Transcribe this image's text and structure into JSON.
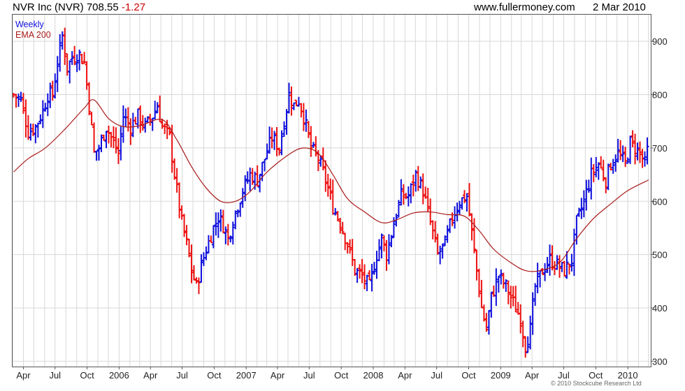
{
  "header": {
    "title": "NVR Inc (NVR) 708.55",
    "change": "-1.27",
    "site": "www.fullermoney.com",
    "date": "2 Mar 2010"
  },
  "copyright": "© 2010 Stockcube Research Ltd",
  "colors": {
    "up": "#1010dd",
    "down": "#ee1111",
    "ema": "#aa1a1a",
    "grid": "#d8d8d8",
    "frame": "#555555",
    "change_text": "#cc0000"
  },
  "chart_data": {
    "type": "ohlc-bar",
    "title": "NVR Inc (NVR) 708.55 -1.27",
    "legend": [
      "Weekly",
      "EMA 200"
    ],
    "legend_placement": "top-left",
    "grid": true,
    "y_axis_side": "right",
    "ylim": [
      290,
      950
    ],
    "y_ticks": [
      300,
      400,
      500,
      600,
      700,
      800,
      900
    ],
    "x_ticks": [
      "Apr",
      "Jul",
      "Oct",
      "2006",
      "Apr",
      "Jul",
      "Oct",
      "2007",
      "Apr",
      "Jul",
      "Oct",
      "2008",
      "Apr",
      "Jul",
      "Oct",
      "2009",
      "Apr",
      "Jul",
      "Oct",
      "2010"
    ],
    "x_tick_dates": [
      "2005-04-01",
      "2005-07-01",
      "2005-10-01",
      "2006-01-01",
      "2006-04-01",
      "2006-07-01",
      "2006-10-01",
      "2007-01-01",
      "2007-04-01",
      "2007-07-01",
      "2007-10-01",
      "2008-01-01",
      "2008-04-01",
      "2008-07-01",
      "2008-10-01",
      "2009-01-01",
      "2009-04-01",
      "2009-07-01",
      "2009-10-01",
      "2010-01-01"
    ],
    "x_range": [
      "2005-03-01",
      "2010-03-08"
    ],
    "weekly_close_anchors": [
      [
        "2005-03-04",
        800
      ],
      [
        "2005-03-25",
        790
      ],
      [
        "2005-04-15",
        730
      ],
      [
        "2005-05-06",
        740
      ],
      [
        "2005-05-27",
        770
      ],
      [
        "2005-06-10",
        800
      ],
      [
        "2005-06-24",
        800
      ],
      [
        "2005-07-08",
        860
      ],
      [
        "2005-07-22",
        910
      ],
      [
        "2005-08-05",
        850
      ],
      [
        "2005-08-19",
        870
      ],
      [
        "2005-09-09",
        875
      ],
      [
        "2005-09-23",
        860
      ],
      [
        "2005-10-07",
        780
      ],
      [
        "2005-10-21",
        690
      ],
      [
        "2005-11-04",
        700
      ],
      [
        "2005-11-25",
        740
      ],
      [
        "2005-12-09",
        720
      ],
      [
        "2005-12-30",
        690
      ],
      [
        "2006-01-13",
        760
      ],
      [
        "2006-02-03",
        740
      ],
      [
        "2006-02-24",
        760
      ],
      [
        "2006-03-17",
        740
      ],
      [
        "2006-04-07",
        760
      ],
      [
        "2006-04-21",
        780
      ],
      [
        "2006-05-05",
        740
      ],
      [
        "2006-05-26",
        720
      ],
      [
        "2006-06-09",
        650
      ],
      [
        "2006-06-30",
        560
      ],
      [
        "2006-07-14",
        520
      ],
      [
        "2006-07-28",
        470
      ],
      [
        "2006-08-11",
        440
      ],
      [
        "2006-08-25",
        480
      ],
      [
        "2006-09-08",
        510
      ],
      [
        "2006-09-29",
        550
      ],
      [
        "2006-10-13",
        570
      ],
      [
        "2006-10-27",
        555
      ],
      [
        "2006-11-10",
        530
      ],
      [
        "2006-12-01",
        580
      ],
      [
        "2006-12-22",
        620
      ],
      [
        "2007-01-12",
        650
      ],
      [
        "2007-02-02",
        640
      ],
      [
        "2007-02-23",
        680
      ],
      [
        "2007-03-16",
        720
      ],
      [
        "2007-04-06",
        700
      ],
      [
        "2007-04-20",
        750
      ],
      [
        "2007-05-04",
        800
      ],
      [
        "2007-05-18",
        780
      ],
      [
        "2007-06-01",
        790
      ],
      [
        "2007-06-15",
        760
      ],
      [
        "2007-07-06",
        700
      ],
      [
        "2007-07-27",
        680
      ],
      [
        "2007-08-17",
        640
      ],
      [
        "2007-09-07",
        590
      ],
      [
        "2007-09-28",
        560
      ],
      [
        "2007-10-19",
        520
      ],
      [
        "2007-11-09",
        470
      ],
      [
        "2007-11-30",
        460
      ],
      [
        "2007-12-21",
        440
      ],
      [
        "2008-01-11",
        500
      ],
      [
        "2008-01-25",
        530
      ],
      [
        "2008-02-08",
        500
      ],
      [
        "2008-02-29",
        560
      ],
      [
        "2008-03-21",
        610
      ],
      [
        "2008-04-11",
        610
      ],
      [
        "2008-05-02",
        650
      ],
      [
        "2008-05-23",
        620
      ],
      [
        "2008-06-13",
        560
      ],
      [
        "2008-07-04",
        500
      ],
      [
        "2008-07-25",
        520
      ],
      [
        "2008-08-15",
        570
      ],
      [
        "2008-09-05",
        600
      ],
      [
        "2008-09-26",
        610
      ],
      [
        "2008-10-10",
        540
      ],
      [
        "2008-10-24",
        470
      ],
      [
        "2008-11-07",
        400
      ],
      [
        "2008-11-21",
        360
      ],
      [
        "2008-12-05",
        420
      ],
      [
        "2008-12-26",
        460
      ],
      [
        "2009-01-16",
        440
      ],
      [
        "2009-02-06",
        410
      ],
      [
        "2009-02-27",
        380
      ],
      [
        "2009-03-13",
        330
      ],
      [
        "2009-03-27",
        360
      ],
      [
        "2009-04-10",
        440
      ],
      [
        "2009-05-01",
        470
      ],
      [
        "2009-05-22",
        490
      ],
      [
        "2009-06-12",
        480
      ],
      [
        "2009-07-03",
        470
      ],
      [
        "2009-07-24",
        490
      ],
      [
        "2009-08-07",
        560
      ],
      [
        "2009-08-28",
        600
      ],
      [
        "2009-09-18",
        650
      ],
      [
        "2009-10-09",
        670
      ],
      [
        "2009-10-30",
        640
      ],
      [
        "2009-11-13",
        670
      ],
      [
        "2009-12-04",
        690
      ],
      [
        "2009-12-25",
        670
      ],
      [
        "2010-01-08",
        710
      ],
      [
        "2010-01-22",
        700
      ],
      [
        "2010-02-05",
        690
      ],
      [
        "2010-02-19",
        670
      ],
      [
        "2010-03-02",
        708.55
      ]
    ],
    "ema200_anchors": [
      [
        "2005-03-04",
        655
      ],
      [
        "2005-04-15",
        680
      ],
      [
        "2005-06-03",
        700
      ],
      [
        "2005-07-29",
        735
      ],
      [
        "2005-09-23",
        775
      ],
      [
        "2005-10-21",
        790
      ],
      [
        "2005-12-02",
        755
      ],
      [
        "2006-01-13",
        740
      ],
      [
        "2006-03-03",
        742
      ],
      [
        "2006-05-05",
        753
      ],
      [
        "2006-06-16",
        715
      ],
      [
        "2006-07-28",
        665
      ],
      [
        "2006-09-08",
        625
      ],
      [
        "2006-10-20",
        600
      ],
      [
        "2006-12-01",
        600
      ],
      [
        "2007-01-12",
        618
      ],
      [
        "2007-03-02",
        655
      ],
      [
        "2007-05-04",
        688
      ],
      [
        "2007-06-15",
        700
      ],
      [
        "2007-07-27",
        690
      ],
      [
        "2007-09-07",
        650
      ],
      [
        "2007-10-19",
        605
      ],
      [
        "2007-12-07",
        580
      ],
      [
        "2008-01-25",
        560
      ],
      [
        "2008-03-07",
        565
      ],
      [
        "2008-04-25",
        578
      ],
      [
        "2008-06-13",
        580
      ],
      [
        "2008-08-01",
        575
      ],
      [
        "2008-09-19",
        572
      ],
      [
        "2008-10-31",
        545
      ],
      [
        "2008-12-12",
        510
      ],
      [
        "2009-01-30",
        485
      ],
      [
        "2009-03-13",
        470
      ],
      [
        "2009-04-24",
        470
      ],
      [
        "2009-06-19",
        485
      ],
      [
        "2009-08-07",
        530
      ],
      [
        "2009-09-25",
        568
      ],
      [
        "2009-11-13",
        595
      ],
      [
        "2010-01-01",
        620
      ],
      [
        "2010-03-02",
        640
      ]
    ]
  }
}
